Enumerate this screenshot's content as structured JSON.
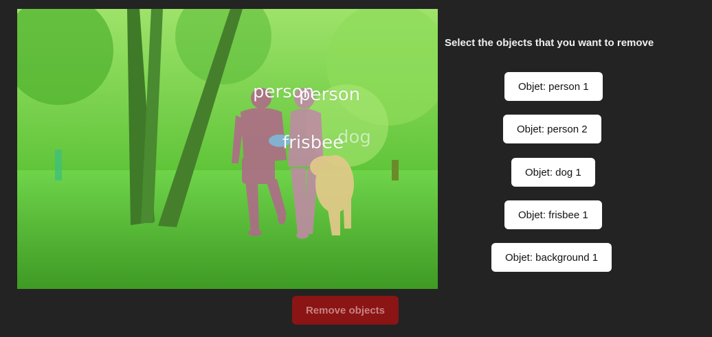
{
  "image": {
    "labels": [
      "person",
      "person",
      "frisbee",
      "dog"
    ]
  },
  "prompt": "Select the objects that you want to remove",
  "objects": [
    {
      "label": "Objet: person 1"
    },
    {
      "label": "Objet: person 2"
    },
    {
      "label": "Objet: dog 1"
    },
    {
      "label": "Objet: frisbee 1"
    },
    {
      "label": "Objet: background 1"
    }
  ],
  "remove_button": "Remove objects",
  "colors": {
    "page_bg": "#232323",
    "mask_background": "#6fd14a",
    "mask_person": "#b06a8a",
    "mask_dog": "#e2c98a",
    "remove_button_bg": "#8b1414"
  }
}
